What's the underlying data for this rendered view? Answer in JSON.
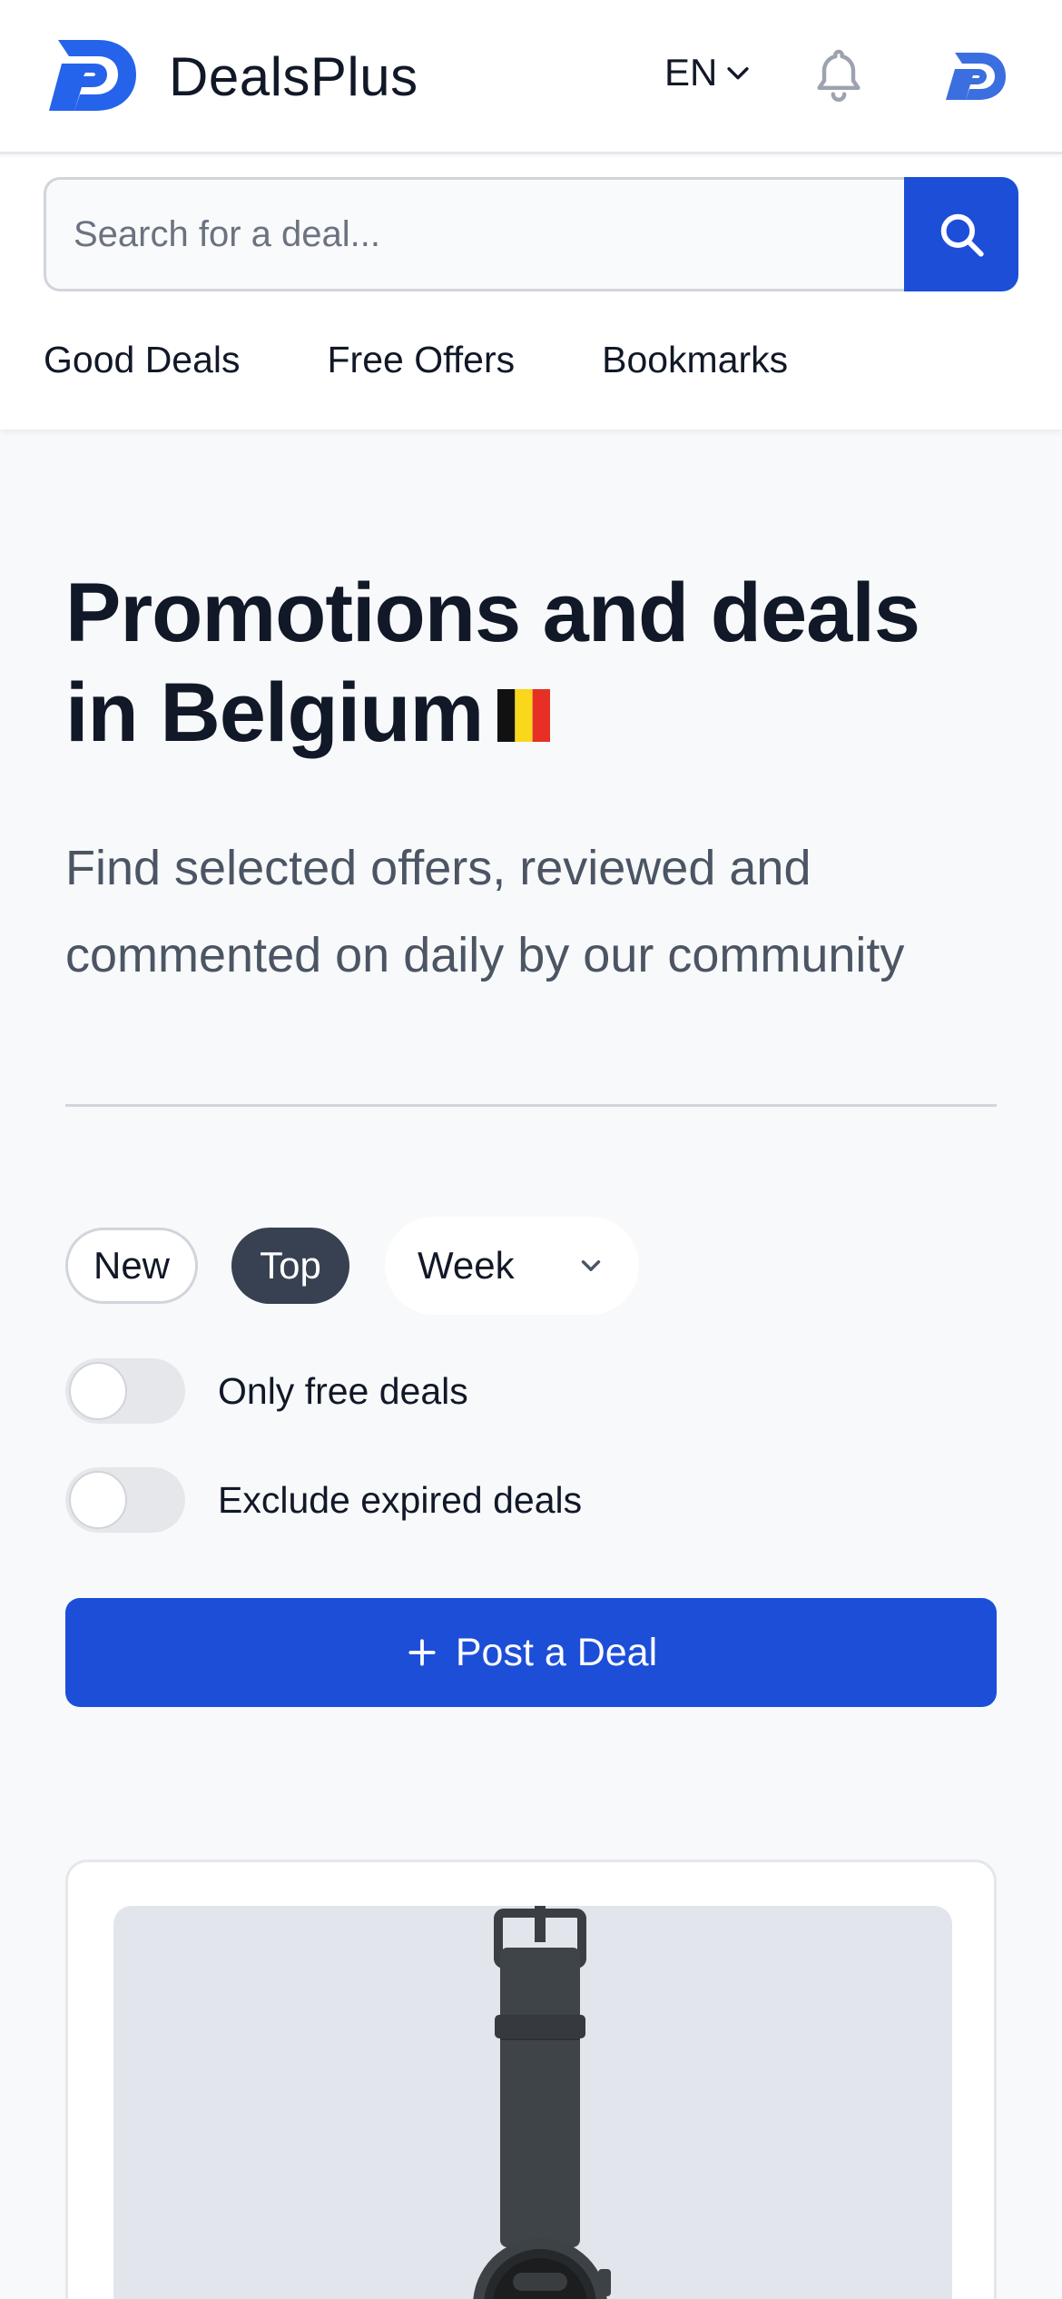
{
  "header": {
    "brand": "DealsPlus",
    "language": "EN"
  },
  "search": {
    "placeholder": "Search for a deal..."
  },
  "nav": {
    "items": [
      {
        "label": "Good Deals"
      },
      {
        "label": "Free Offers"
      },
      {
        "label": "Bookmarks"
      }
    ]
  },
  "hero": {
    "title": "Promotions and deals in Belgium",
    "subtitle": "Find selected offers, reviewed and commented on daily by our community"
  },
  "filters": {
    "new_label": "New",
    "top_label": "Top",
    "top_selected": true,
    "period": "Week",
    "free_label": "Only free deals",
    "free_on": false,
    "expired_label": "Exclude expired deals",
    "expired_on": false
  },
  "post_button": {
    "label": "Post a Deal"
  },
  "colors": {
    "primary": "#1d4ed8",
    "dark_pill": "#374151",
    "logo_blue": "#2563eb"
  }
}
